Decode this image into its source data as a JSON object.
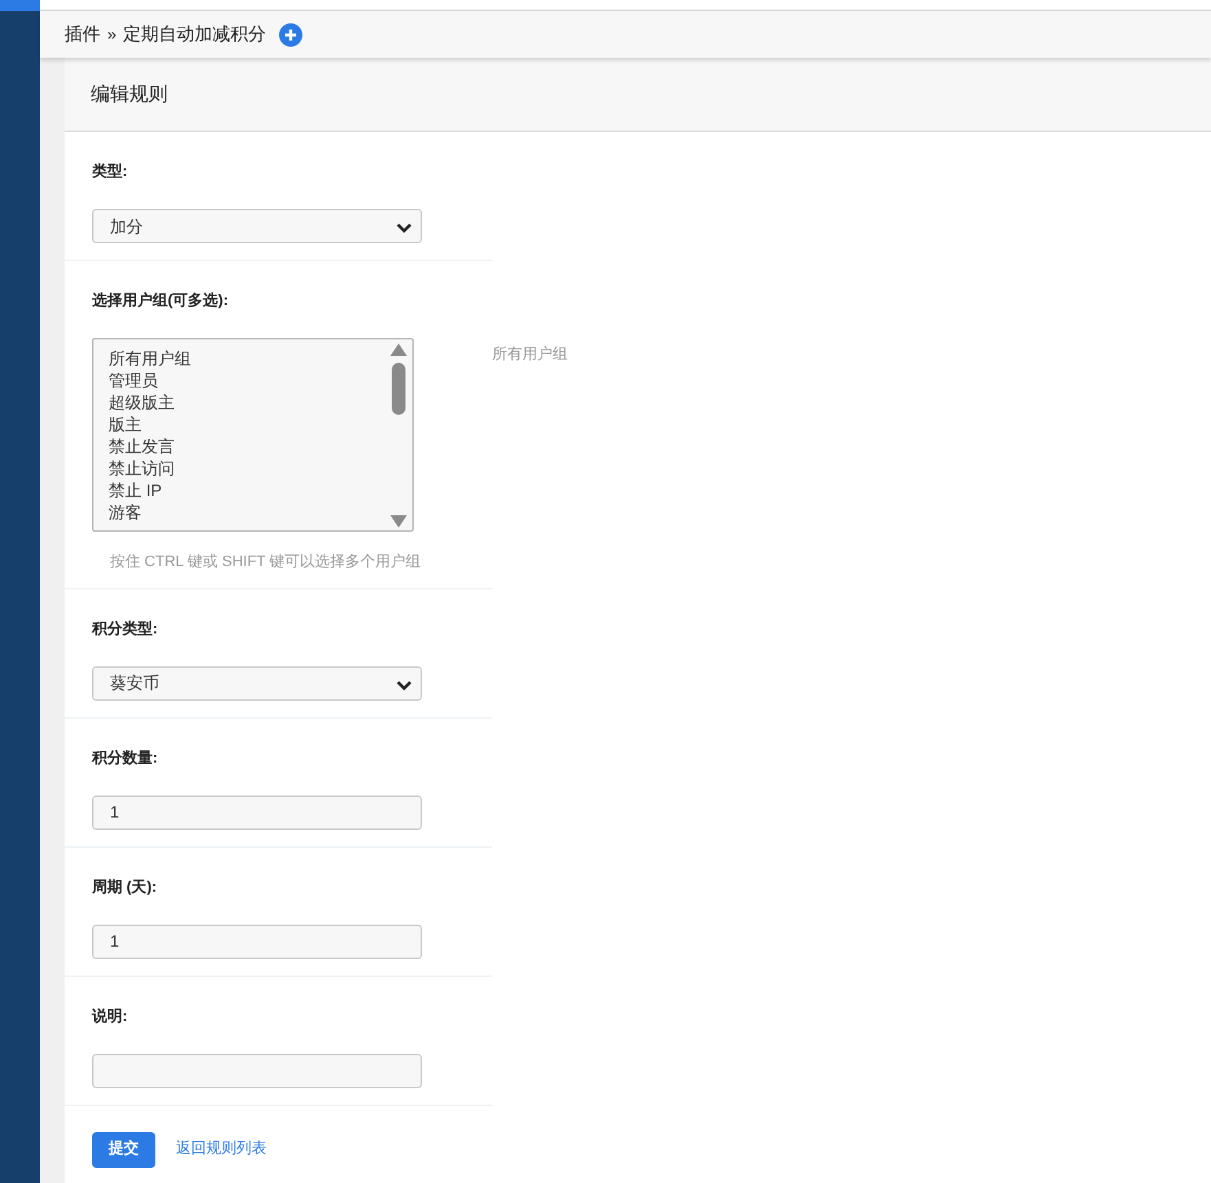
{
  "breadcrumb": {
    "items": [
      "插件",
      "定期自动加减积分"
    ],
    "separator": "»"
  },
  "panel": {
    "title": "编辑规则"
  },
  "fields": [
    {
      "kind": "select",
      "label": "类型:",
      "value": "加分"
    },
    {
      "kind": "listbox",
      "label": "选择用户组(可多选):",
      "options": [
        {
          "label": "所有用户组",
          "selected": false
        },
        {
          "label": "管理员",
          "selected": false
        },
        {
          "label": "超级版主",
          "selected": false
        },
        {
          "label": "版主",
          "selected": false
        },
        {
          "label": "禁止发言",
          "selected": false
        },
        {
          "label": "禁止访问",
          "selected": false
        },
        {
          "label": "禁止 IP",
          "selected": false
        },
        {
          "label": "游客",
          "selected": false
        }
      ],
      "hint": "按住 CTRL 键或 SHIFT 键可以选择多个用户组",
      "side_note": "所有用户组"
    },
    {
      "kind": "select",
      "label": "积分类型:",
      "value": "葵安币"
    },
    {
      "kind": "input",
      "label": "积分数量:",
      "value": "1"
    },
    {
      "kind": "input",
      "label": "周期 (天):",
      "value": "1"
    },
    {
      "kind": "input",
      "label": "说明:"
    }
  ],
  "actions": {
    "submit": "提交",
    "back_link": "返回规则列表"
  }
}
